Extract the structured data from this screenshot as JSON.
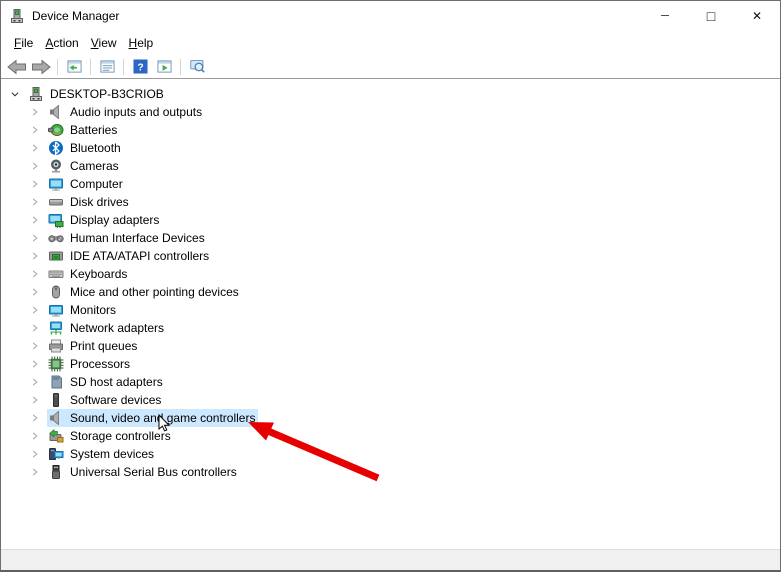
{
  "window": {
    "title": "Device Manager",
    "controls": [
      {
        "name": "minimize",
        "glyph": "─"
      },
      {
        "name": "maximize",
        "glyph": "□"
      },
      {
        "name": "close",
        "glyph": "✕"
      }
    ]
  },
  "menu_bar": {
    "items": [
      {
        "label": "File"
      },
      {
        "label": "Action"
      },
      {
        "label": "View"
      },
      {
        "label": "Help"
      }
    ]
  },
  "toolbar": {
    "buttons": [
      {
        "name": "back",
        "icon": "back-arrow-icon"
      },
      {
        "name": "forward",
        "icon": "forward-arrow-icon"
      },
      {
        "separator": true
      },
      {
        "name": "show-console-tree",
        "icon": "console-tree-icon"
      },
      {
        "separator": true
      },
      {
        "name": "properties",
        "icon": "properties-icon"
      },
      {
        "separator": true
      },
      {
        "name": "help",
        "icon": "help-icon"
      },
      {
        "name": "action-pane",
        "icon": "action-pane-icon"
      },
      {
        "separator": true
      },
      {
        "name": "scan-hardware-changes",
        "icon": "scan-hardware-icon"
      }
    ]
  },
  "tree": {
    "root": {
      "label": "DESKTOP-B3CRIOB",
      "icon": "computer-device-icon",
      "expanded": true
    },
    "items": [
      {
        "label": "Audio inputs and outputs",
        "icon": "speaker-icon"
      },
      {
        "label": "Batteries",
        "icon": "battery-icon"
      },
      {
        "label": "Bluetooth",
        "icon": "bluetooth-icon"
      },
      {
        "label": "Cameras",
        "icon": "camera-icon"
      },
      {
        "label": "Computer",
        "icon": "computer-icon"
      },
      {
        "label": "Disk drives",
        "icon": "disk-drive-icon"
      },
      {
        "label": "Display adapters",
        "icon": "display-adapter-icon"
      },
      {
        "label": "Human Interface Devices",
        "icon": "gamepad-icon"
      },
      {
        "label": "IDE ATA/ATAPI controllers",
        "icon": "ide-controller-icon"
      },
      {
        "label": "Keyboards",
        "icon": "keyboard-icon"
      },
      {
        "label": "Mice and other pointing devices",
        "icon": "mouse-icon"
      },
      {
        "label": "Monitors",
        "icon": "monitor-icon"
      },
      {
        "label": "Network adapters",
        "icon": "network-adapter-icon"
      },
      {
        "label": "Print queues",
        "icon": "printer-icon"
      },
      {
        "label": "Processors",
        "icon": "processor-icon"
      },
      {
        "label": "SD host adapters",
        "icon": "sd-card-icon"
      },
      {
        "label": "Software devices",
        "icon": "software-device-icon"
      },
      {
        "label": "Sound, video and game controllers",
        "icon": "speaker-icon",
        "selected": true
      },
      {
        "label": "Storage controllers",
        "icon": "storage-controller-icon"
      },
      {
        "label": "System devices",
        "icon": "system-device-icon"
      },
      {
        "label": "Universal Serial Bus controllers",
        "icon": "usb-icon"
      }
    ]
  },
  "status_bar": {
    "text": ""
  },
  "colors": {
    "selection_background": "#cce8ff",
    "annotation_arrow": "#e60000",
    "status_bar_background": "#f0f0f0"
  }
}
